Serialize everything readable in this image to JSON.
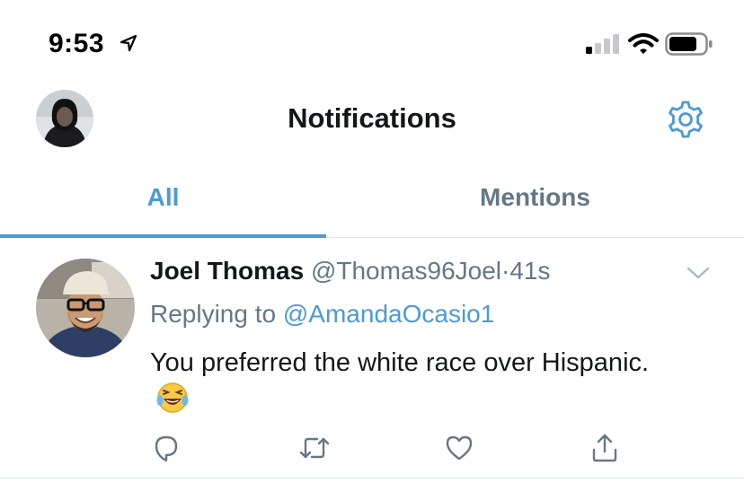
{
  "status_bar": {
    "time": "9:53"
  },
  "header": {
    "title": "Notifications"
  },
  "tabs": [
    {
      "label": "All",
      "active": true
    },
    {
      "label": "Mentions",
      "active": false
    }
  ],
  "tweet": {
    "author_name": "Joel Thomas",
    "handle": "@Thomas96Joel",
    "separator": "·",
    "time": "41s",
    "reply_prefix": "Replying to",
    "reply_to": "@AmandaOcasio1",
    "text": "You preferred the white race over Hispanic."
  },
  "colors": {
    "accent": "#4b9bd5",
    "secondary_text": "#657786",
    "primary_text": "#14171a",
    "divider": "#e1e8ed"
  },
  "icons": [
    "location-arrow-icon",
    "cellular-signal-icon",
    "wifi-icon",
    "battery-icon",
    "gear-icon",
    "chevron-down-icon",
    "reply-icon",
    "retweet-icon",
    "like-icon",
    "share-icon",
    "laughing-emoji"
  ]
}
